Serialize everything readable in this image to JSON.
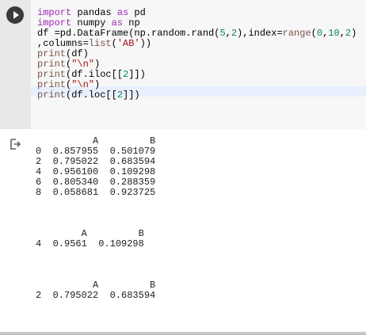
{
  "cell": {
    "run_icon": "play-icon",
    "output_icon": "output-arrow-icon",
    "highlight_color": "#e8f0fe"
  },
  "code_lines": [
    [
      {
        "t": "import",
        "c": "kw"
      },
      {
        "t": " pandas ",
        "c": ""
      },
      {
        "t": "as",
        "c": "kw"
      },
      {
        "t": " pd",
        "c": ""
      }
    ],
    [
      {
        "t": "import",
        "c": "kw"
      },
      {
        "t": " numpy ",
        "c": ""
      },
      {
        "t": "as",
        "c": "kw"
      },
      {
        "t": " np",
        "c": ""
      }
    ],
    [
      {
        "t": "df =pd.DataFrame(np.random.rand(",
        "c": ""
      },
      {
        "t": "5",
        "c": "num"
      },
      {
        "t": ",",
        "c": ""
      },
      {
        "t": "2",
        "c": "num"
      },
      {
        "t": "),index=",
        "c": ""
      },
      {
        "t": "range",
        "c": "fn"
      },
      {
        "t": "(",
        "c": ""
      },
      {
        "t": "0",
        "c": "num"
      },
      {
        "t": ",",
        "c": ""
      },
      {
        "t": "10",
        "c": "num"
      },
      {
        "t": ",",
        "c": ""
      },
      {
        "t": "2",
        "c": "num"
      },
      {
        "t": ")",
        "c": ""
      }
    ],
    [
      {
        "t": ",columns=",
        "c": ""
      },
      {
        "t": "list",
        "c": "fn"
      },
      {
        "t": "(",
        "c": ""
      },
      {
        "t": "'AB'",
        "c": "str"
      },
      {
        "t": "))",
        "c": ""
      }
    ],
    [
      {
        "t": "print",
        "c": "fn"
      },
      {
        "t": "(df)",
        "c": ""
      }
    ],
    [
      {
        "t": "print",
        "c": "fn"
      },
      {
        "t": "(",
        "c": ""
      },
      {
        "t": "\"\\n\"",
        "c": "str"
      },
      {
        "t": ")",
        "c": ""
      }
    ],
    [
      {
        "t": "print",
        "c": "fn"
      },
      {
        "t": "(df.iloc[[",
        "c": ""
      },
      {
        "t": "2",
        "c": "num"
      },
      {
        "t": "]])",
        "c": ""
      }
    ],
    [
      {
        "t": "print",
        "c": "fn"
      },
      {
        "t": "(",
        "c": ""
      },
      {
        "t": "\"\\n\"",
        "c": "str"
      },
      {
        "t": ")",
        "c": ""
      }
    ],
    [
      {
        "t": "print",
        "c": "fn"
      },
      {
        "t": "(df.loc[[",
        "c": ""
      },
      {
        "t": "2",
        "c": "num"
      },
      {
        "t": "]])",
        "c": ""
      }
    ]
  ],
  "output_lines": [
    "          A         B",
    "0  0.857955  0.501079",
    "2  0.795022  0.683594",
    "4  0.956100  0.109298",
    "6  0.805340  0.288359",
    "8  0.058681  0.923725",
    "",
    "",
    "",
    "        A         B",
    "4  0.9561  0.109298",
    "",
    "",
    "",
    "          A         B",
    "2  0.795022  0.683594"
  ]
}
